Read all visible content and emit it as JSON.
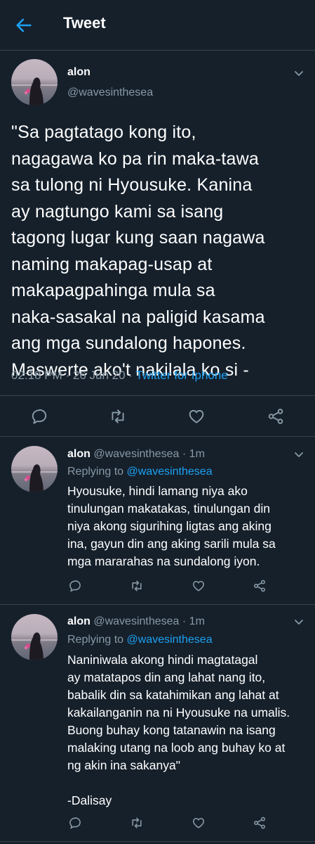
{
  "header": {
    "title": "Tweet",
    "back_icon": "arrow-left-icon",
    "accent": "#1da1f2"
  },
  "main_tweet": {
    "name": "alon",
    "handle": "@wavesinthesea",
    "lines": [
      "\"Sa pagtatago kong ito,",
      "nagagawa ko pa rin maka-tawa",
      "sa tulong ni Hyousuke. Kanina",
      "ay nagtungo kami sa isang",
      "tagong lugar kung saan nagawa",
      "naming makapag-usap at",
      "makapagpahinga mula sa",
      "naka-sasakal na paligid kasama",
      "ang mga sundalong hapones.",
      "Maswerte ako't nakilala ko si -"
    ],
    "time": "02:18 PM",
    "date": "26 Jun 20",
    "separator": "·",
    "source": "Twitter for Iphone"
  },
  "replies": [
    {
      "name": "alon",
      "handle": "@wavesinthesea",
      "separator": "·",
      "time": "1m",
      "replying_prefix": "Replying to",
      "replying_to": "@wavesinthesea",
      "lines": [
        "Hyousuke, hindi lamang niya ako",
        "tinulungan makatakas, tinulungan din",
        "niya akong sigurihing ligtas ang aking",
        "ina, gayun din ang aking sarili mula sa",
        "mga mararahas na sundalong iyon."
      ]
    },
    {
      "name": "alon",
      "handle": "@wavesinthesea",
      "separator": "·",
      "time": "1m",
      "replying_prefix": "Replying to",
      "replying_to": "@wavesinthesea",
      "lines": [
        "Naniniwala akong hindi magtatagal",
        "ay matatapos din ang lahat nang ito,",
        "babalik din sa katahimikan ang lahat at",
        "kakailanganin na ni Hyousuke na umalis.",
        "Buong buhay kong tatanawin na isang",
        "malaking utang na loob ang buhay ko at",
        "ng akin ina sakanya\"",
        "",
        "-Dalisay"
      ]
    }
  ]
}
